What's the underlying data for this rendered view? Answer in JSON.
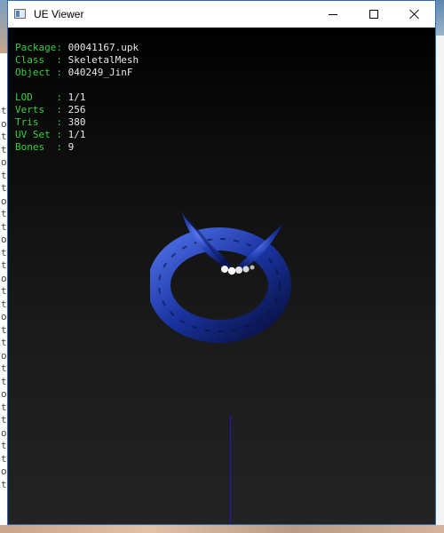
{
  "window": {
    "title": "UE Viewer"
  },
  "info": {
    "package": {
      "label": "Package: ",
      "value": "00041167.upk"
    },
    "class": {
      "label": "Class  : ",
      "value": "SkeletalMesh"
    },
    "object": {
      "label": "Object : ",
      "value": "040249_JinF"
    },
    "lod": {
      "label": "LOD    : ",
      "value": "1/1"
    },
    "verts": {
      "label": "Verts  : ",
      "value": "256"
    },
    "tris": {
      "label": "Tris   : ",
      "value": "380"
    },
    "uvset": {
      "label": "UV Set : ",
      "value": "1/1"
    },
    "bones": {
      "label": "Bones  : ",
      "value": "9"
    }
  },
  "colors": {
    "label": "#36d13a",
    "value": "#e8e8e8",
    "axis": "#1b1bc8",
    "mesh": "#1e3a9e"
  },
  "background_letters": [
    "t",
    "o",
    "t",
    "t",
    "o",
    "t",
    "t",
    "o",
    "t",
    "t",
    "o",
    "t",
    "t",
    "o",
    "t",
    "t",
    "o",
    "t",
    "t",
    "o",
    "t",
    "t",
    "o",
    "t",
    "t",
    "o",
    "t",
    "t",
    "o",
    "t"
  ]
}
